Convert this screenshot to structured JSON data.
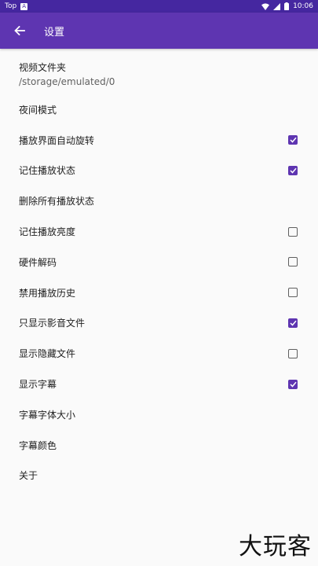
{
  "status_bar": {
    "left_label": "Top",
    "time": "10:06",
    "icons": [
      "notification-icon",
      "wifi-icon",
      "signal-icon",
      "battery-icon"
    ]
  },
  "app_bar": {
    "title": "设置",
    "back_icon": "arrow-back-icon"
  },
  "settings": {
    "video_folder": {
      "label": "视频文件夹",
      "value": "/storage/emulated/0"
    },
    "night_mode": {
      "label": "夜间模式"
    },
    "auto_rotate": {
      "label": "播放界面自动旋转",
      "checked": true
    },
    "remember_state": {
      "label": "记住播放状态",
      "checked": true
    },
    "delete_states": {
      "label": "删除所有播放状态"
    },
    "remember_brightness": {
      "label": "记住播放亮度",
      "checked": false
    },
    "hw_decode": {
      "label": "硬件解码",
      "checked": false
    },
    "disable_history": {
      "label": "禁用播放历史",
      "checked": false
    },
    "media_only": {
      "label": "只显示影音文件",
      "checked": true
    },
    "show_hidden": {
      "label": "显示隐藏文件",
      "checked": false
    },
    "show_subtitles": {
      "label": "显示字幕",
      "checked": true
    },
    "subtitle_size": {
      "label": "字幕字体大小"
    },
    "subtitle_color": {
      "label": "字幕颜色"
    },
    "about": {
      "label": "关于"
    }
  },
  "watermark": "大玩客",
  "colors": {
    "primary": "#5e35b1",
    "status_bar": "#4527a0",
    "background": "#fafafa"
  }
}
